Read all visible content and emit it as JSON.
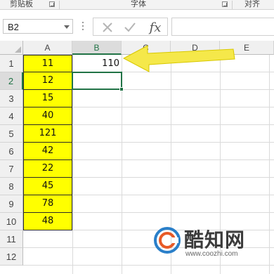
{
  "ribbon": {
    "groups": [
      {
        "label": "剪贴板"
      },
      {
        "label": "字体"
      },
      {
        "label": "对齐"
      }
    ]
  },
  "namebox": {
    "value": "B2"
  },
  "formula_bar": {
    "cancel_icon": "x-icon",
    "enter_icon": "check-icon",
    "fx_label": "fx",
    "value": ""
  },
  "columns": [
    "A",
    "B",
    "C",
    "D",
    "E"
  ],
  "selected_column": "B",
  "rows": [
    "1",
    "2",
    "3",
    "4",
    "5",
    "6",
    "7",
    "8",
    "9",
    "10",
    "11",
    "12"
  ],
  "selected_row": "2",
  "column_a": [
    "11",
    "12",
    "15",
    "40",
    "121",
    "42",
    "22",
    "45",
    "78",
    "48"
  ],
  "b1_value": "110",
  "colors": {
    "highlight": "#ffff00",
    "accent_green": "#217346",
    "arrow": "#f5e84a"
  },
  "watermark": {
    "name": "酷知网",
    "url": "www.coozhi.com"
  }
}
